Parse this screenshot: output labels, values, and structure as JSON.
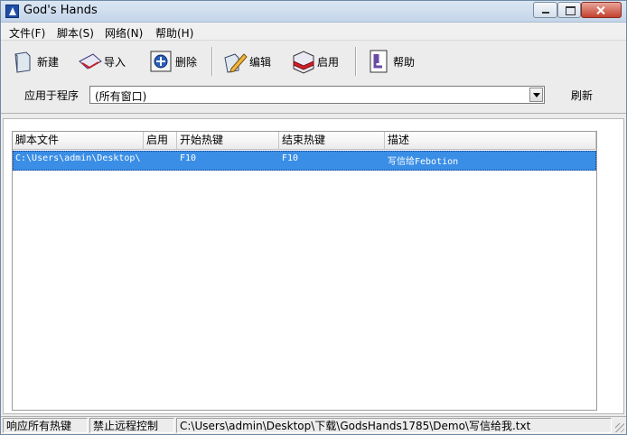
{
  "window": {
    "title": "God's Hands"
  },
  "menu": [
    {
      "label": "文件(F)"
    },
    {
      "label": "脚本(S)"
    },
    {
      "label": "网络(N)"
    },
    {
      "label": "帮助(H)"
    }
  ],
  "toolbar": {
    "new": "新建",
    "import": "导入",
    "delete": "删除",
    "edit": "编辑",
    "enable": "启用",
    "help": "帮助"
  },
  "apply": {
    "label": "应用于程序",
    "value": "(所有窗口)",
    "refresh": "刷新"
  },
  "table": {
    "columns": [
      "脚本文件",
      "启用",
      "开始热键",
      "结束热键",
      "描述"
    ],
    "rows": [
      {
        "file": "C:\\Users\\admin\\Desktop\\",
        "enabled": "",
        "start_key": "F10",
        "end_key": "F10",
        "description": "写信给Febotion"
      }
    ]
  },
  "status": {
    "hotkeys": "响应所有热键",
    "remote": "禁止远程控制",
    "path": "C:\\Users\\admin\\Desktop\\下载\\GodsHands1785\\Demo\\写信给我.txt"
  },
  "colors": {
    "selection": "#3a8ee6",
    "title_gradient_top": "#dbe6f3",
    "close_button": "#c4412e"
  }
}
